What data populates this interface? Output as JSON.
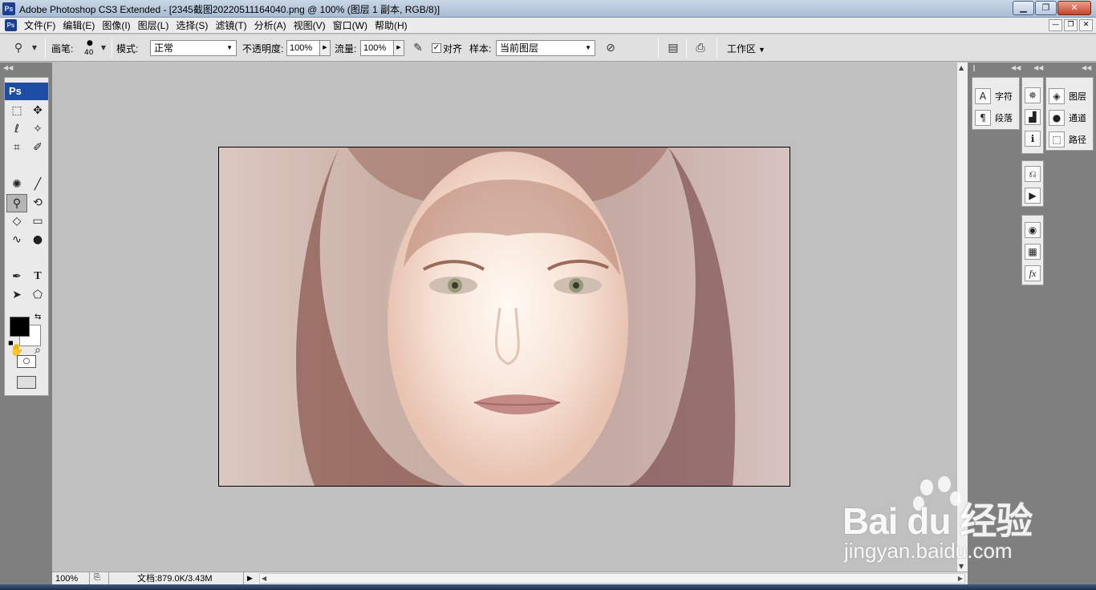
{
  "window": {
    "logo": "Ps",
    "title": "Adobe Photoshop CS3 Extended - [2345截图20220511164040.png @ 100% (图层 1 副本, RGB/8)]"
  },
  "menu": {
    "logo": "Ps",
    "items": [
      "文件(F)",
      "编辑(E)",
      "图像(I)",
      "图层(L)",
      "选择(S)",
      "滤镜(T)",
      "分析(A)",
      "视图(V)",
      "窗口(W)",
      "帮助(H)"
    ]
  },
  "options": {
    "brush_label": "画笔:",
    "brush_size": "40",
    "mode_label": "模式:",
    "mode_value": "正常",
    "opacity_label": "不透明度:",
    "opacity_value": "100%",
    "flow_label": "流量:",
    "flow_value": "100%",
    "align_label": "对齐",
    "align_checked": true,
    "sample_label": "样本:",
    "sample_value": "当前图层",
    "workspace_label": "工作区"
  },
  "toolbox": {
    "logo": "Ps",
    "active_tool": "clone-stamp",
    "foreground_color": "#000000",
    "background_color": "#ffffff"
  },
  "status": {
    "zoom": "100%",
    "doc_info": "文档:879.0K/3.43M"
  },
  "panels": {
    "group1": [
      {
        "icon": "character-icon",
        "glyph": "A",
        "label": "字符"
      },
      {
        "icon": "paragraph-icon",
        "glyph": "¶",
        "label": "段落"
      }
    ],
    "group3": [
      {
        "icon": "layers-icon",
        "glyph": "◈",
        "label": "图层"
      },
      {
        "icon": "channels-icon",
        "glyph": "●",
        "label": "通道"
      },
      {
        "icon": "paths-icon",
        "glyph": "⬚",
        "label": "路径"
      }
    ]
  },
  "watermark": {
    "brand": "Bai du 经验",
    "url": "jingyan.baidu.com"
  }
}
